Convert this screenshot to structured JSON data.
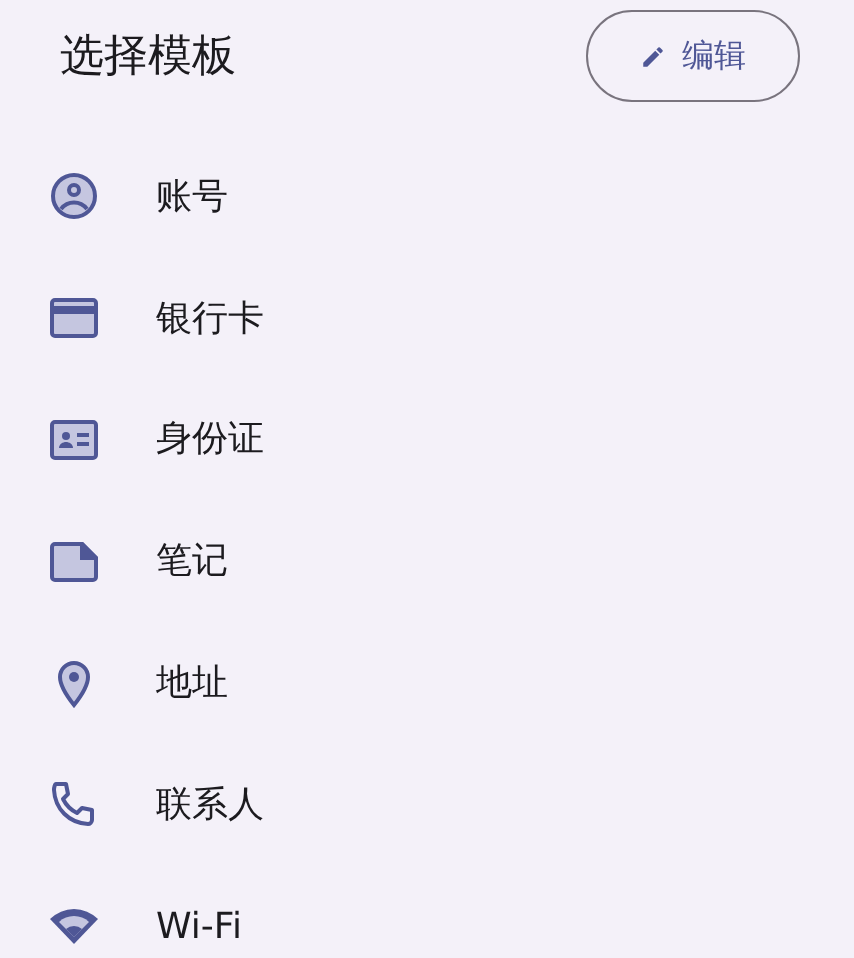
{
  "header": {
    "title": "选择模板",
    "edit_button": "编辑"
  },
  "templates": [
    {
      "kind": "account",
      "label": "账号"
    },
    {
      "kind": "card",
      "label": "银行卡"
    },
    {
      "kind": "id",
      "label": "身份证"
    },
    {
      "kind": "note",
      "label": "笔记"
    },
    {
      "kind": "location",
      "label": "地址"
    },
    {
      "kind": "phone",
      "label": "联系人"
    },
    {
      "kind": "wifi",
      "label": "Wi-Fi"
    }
  ]
}
